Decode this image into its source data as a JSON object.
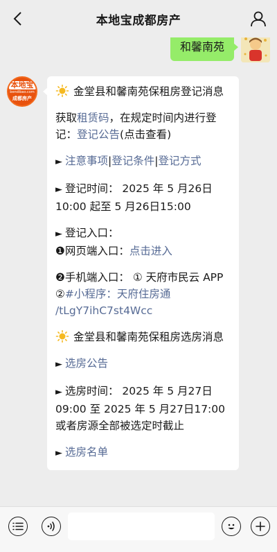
{
  "header": {
    "title": "本地宝成都房产"
  },
  "sent_message": {
    "text": "和馨南苑"
  },
  "bot": {
    "logo_main": "本地宝",
    "logo_sub": "bendibao.com",
    "logo_foot": "成都房产"
  },
  "message": {
    "section1_title": "金堂县和馨南苑保租房登记消息",
    "intro_before": "获取",
    "intro_link": "租赁码",
    "intro_after": "，在规定时间内进行登记：",
    "notice_link": "登记公告",
    "notice_after": "(点击查看)",
    "tab_links": [
      "注意事项",
      "登记条件",
      "登记方式"
    ],
    "tab_sep": "|",
    "reg_time": "登记时间： 2025 年 5 月26日 10:00 起至 5 月26日15:00",
    "reg_entry_label": "登记入口：",
    "web_entry_num": "❶",
    "web_entry_label": "网页端入口：",
    "web_entry_link": "点击进入",
    "mobile_entry_num": "❷",
    "mobile_entry_text": "手机端入口： ① 天府市民云 APP ②",
    "mobile_entry_link": "#小程序：天府住房通 /tLgY7ihC7st4Wcc",
    "section2_title": "金堂县和馨南苑保租房选房消息",
    "select_notice_link": "选房公告",
    "select_time": "选房时间： 2025 年 5 月27日 09:00 至 2025 年 5 月27日17:00 或者房源全部被选定时截止",
    "select_list_link": "选房名单",
    "bullet": "►"
  },
  "input": {
    "placeholder": ""
  }
}
